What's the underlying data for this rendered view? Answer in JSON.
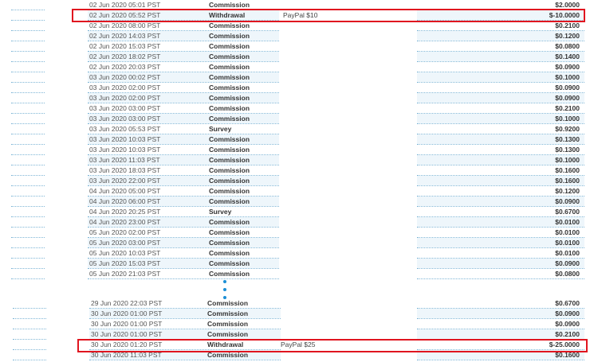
{
  "top_rows": [
    {
      "date": "02 Jun 2020 05:01 PST",
      "type": "Commission",
      "note": "",
      "amount": "$2.0000"
    },
    {
      "date": "02 Jun 2020 05:52 PST",
      "type": "Withdrawal",
      "note": "PayPal $10",
      "amount": "$-10.0000"
    },
    {
      "date": "02 Jun 2020 08:00 PST",
      "type": "Commission",
      "note": "",
      "amount": "$0.2100"
    },
    {
      "date": "02 Jun 2020 14:03 PST",
      "type": "Commission",
      "note": "",
      "amount": "$0.1200"
    },
    {
      "date": "02 Jun 2020 15:03 PST",
      "type": "Commission",
      "note": "",
      "amount": "$0.0800"
    },
    {
      "date": "02 Jun 2020 18:02 PST",
      "type": "Commission",
      "note": "",
      "amount": "$0.1400"
    },
    {
      "date": "02 Jun 2020 20:03 PST",
      "type": "Commission",
      "note": "",
      "amount": "$0.0900"
    },
    {
      "date": "03 Jun 2020 00:02 PST",
      "type": "Commission",
      "note": "",
      "amount": "$0.1000"
    },
    {
      "date": "03 Jun 2020 02:00 PST",
      "type": "Commission",
      "note": "",
      "amount": "$0.0900"
    },
    {
      "date": "03 Jun 2020 02:00 PST",
      "type": "Commission",
      "note": "",
      "amount": "$0.0900"
    },
    {
      "date": "03 Jun 2020 03:00 PST",
      "type": "Commission",
      "note": "",
      "amount": "$0.2100"
    },
    {
      "date": "03 Jun 2020 03:00 PST",
      "type": "Commission",
      "note": "",
      "amount": "$0.1000"
    },
    {
      "date": "03 Jun 2020 05:53 PST",
      "type": "Survey",
      "note": "",
      "amount": "$0.9200"
    },
    {
      "date": "03 Jun 2020 10:03 PST",
      "type": "Commission",
      "note": "",
      "amount": "$0.1300"
    },
    {
      "date": "03 Jun 2020 10:03 PST",
      "type": "Commission",
      "note": "",
      "amount": "$0.1300"
    },
    {
      "date": "03 Jun 2020 11:03 PST",
      "type": "Commission",
      "note": "",
      "amount": "$0.1000"
    },
    {
      "date": "03 Jun 2020 18:03 PST",
      "type": "Commission",
      "note": "",
      "amount": "$0.1600"
    },
    {
      "date": "03 Jun 2020 22:00 PST",
      "type": "Commission",
      "note": "",
      "amount": "$0.1600"
    },
    {
      "date": "04 Jun 2020 05:00 PST",
      "type": "Commission",
      "note": "",
      "amount": "$0.1200"
    },
    {
      "date": "04 Jun 2020 06:00 PST",
      "type": "Commission",
      "note": "",
      "amount": "$0.0900"
    },
    {
      "date": "04 Jun 2020 20:25 PST",
      "type": "Survey",
      "note": "",
      "amount": "$0.6700"
    },
    {
      "date": "04 Jun 2020 23:00 PST",
      "type": "Commission",
      "note": "",
      "amount": "$0.0100"
    },
    {
      "date": "05 Jun 2020 02:00 PST",
      "type": "Commission",
      "note": "",
      "amount": "$0.0100"
    },
    {
      "date": "05 Jun 2020 03:00 PST",
      "type": "Commission",
      "note": "",
      "amount": "$0.0100"
    },
    {
      "date": "05 Jun 2020 10:03 PST",
      "type": "Commission",
      "note": "",
      "amount": "$0.0100"
    },
    {
      "date": "05 Jun 2020 15:03 PST",
      "type": "Commission",
      "note": "",
      "amount": "$0.0900"
    },
    {
      "date": "05 Jun 2020 21:03 PST",
      "type": "Commission",
      "note": "",
      "amount": "$0.0800"
    }
  ],
  "bottom_rows": [
    {
      "date": "29 Jun 2020 22:03 PST",
      "type": "Commission",
      "note": "",
      "amount": "$0.6700"
    },
    {
      "date": "30 Jun 2020 01:00 PST",
      "type": "Commission",
      "note": "",
      "amount": "$0.0900"
    },
    {
      "date": "30 Jun 2020 01:00 PST",
      "type": "Commission",
      "note": "",
      "amount": "$0.0900"
    },
    {
      "date": "30 Jun 2020 01:00 PST",
      "type": "Commission",
      "note": "",
      "amount": "$0.2100"
    },
    {
      "date": "30 Jun 2020 01:20 PST",
      "type": "Withdrawal",
      "note": "PayPal $25",
      "amount": "$-25.0000"
    },
    {
      "date": "30 Jun 2020 11:03 PST",
      "type": "Commission",
      "note": "",
      "amount": "$0.1600"
    }
  ],
  "colors": {
    "highlight": "#e0151f",
    "ellipsis_dots": "#1c8fd6"
  }
}
